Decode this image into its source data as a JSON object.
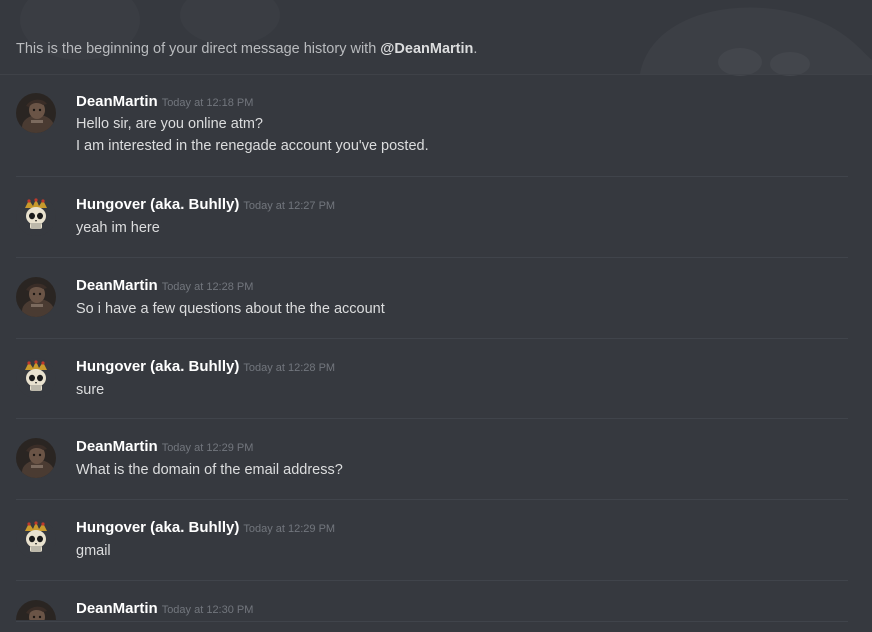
{
  "intro": {
    "prefix": "This is the beginning of your direct message history with ",
    "mention": "@DeanMartin",
    "suffix": "."
  },
  "colors": {
    "background": "#36393f",
    "username": "#ffffff",
    "timestamp": "#72767d",
    "message_text": "#dcddde"
  },
  "messages": [
    {
      "username": "DeanMartin",
      "timestamp": "Today at 12:18 PM",
      "avatar": "dean-avatar-icon",
      "lines": [
        "Hello sir, are you online atm?",
        "I am interested in the renegade account you've posted."
      ]
    },
    {
      "username": "Hungover (aka. Buhlly)",
      "timestamp": "Today at 12:27 PM",
      "avatar": "skull-crown-avatar-icon",
      "lines": [
        "yeah im here"
      ]
    },
    {
      "username": "DeanMartin",
      "timestamp": "Today at 12:28 PM",
      "avatar": "dean-avatar-icon",
      "lines": [
        "So i have a few questions about the the account"
      ]
    },
    {
      "username": "Hungover (aka. Buhlly)",
      "timestamp": "Today at 12:28 PM",
      "avatar": "skull-crown-avatar-icon",
      "lines": [
        "sure"
      ]
    },
    {
      "username": "DeanMartin",
      "timestamp": "Today at 12:29 PM",
      "avatar": "dean-avatar-icon",
      "lines": [
        "What is the domain of the email address?"
      ]
    },
    {
      "username": "Hungover (aka. Buhlly)",
      "timestamp": "Today at 12:29 PM",
      "avatar": "skull-crown-avatar-icon",
      "lines": [
        "gmail"
      ]
    },
    {
      "username": "DeanMartin",
      "timestamp": "Today at 12:30 PM",
      "avatar": "dean-avatar-icon",
      "lines": []
    }
  ]
}
